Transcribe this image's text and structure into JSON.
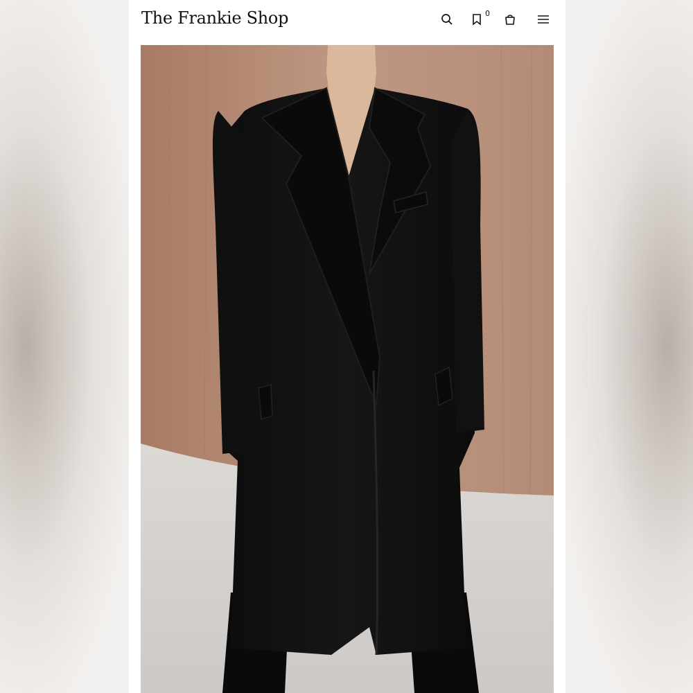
{
  "header": {
    "logo": "The Frankie Shop",
    "wishlist_count": "0"
  },
  "icons": {
    "search": "search-icon",
    "wishlist": "bookmark-icon",
    "cart": "bag-icon",
    "menu": "hamburger-menu-icon"
  },
  "product": {
    "image": "black-long-wool-coat-photo"
  },
  "colors": {
    "accent": "#111111",
    "background": "#ffffff"
  }
}
